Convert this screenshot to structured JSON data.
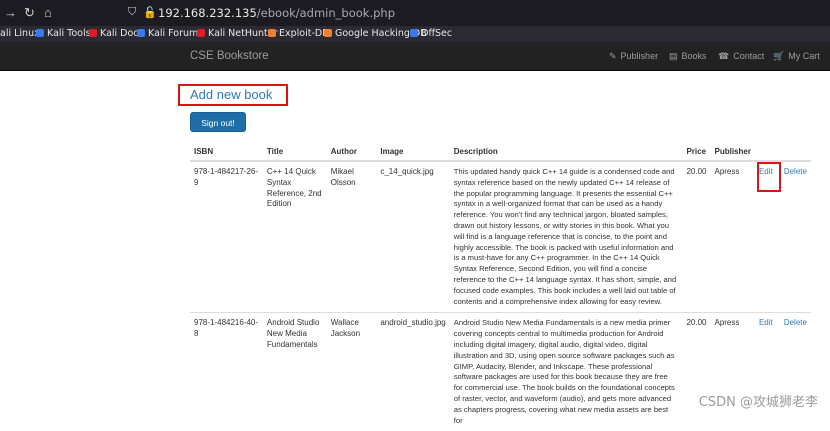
{
  "browser": {
    "url_host": "192.168.232.135",
    "url_path": "/ebook/admin_book.php",
    "bookmarks": [
      {
        "label": "ali Linux",
        "color": "#367bf0"
      },
      {
        "label": "Kali Tools",
        "color": "#e94b3c"
      },
      {
        "label": "Kali Docs",
        "color": "#e31b23"
      },
      {
        "label": "Kali Forums",
        "color": "#367bf0"
      },
      {
        "label": "Kali NetHunter",
        "color": "#e31b23"
      },
      {
        "label": "Exploit-DB",
        "color": "#f08030"
      },
      {
        "label": "Google Hacking DB",
        "color": "#f08030"
      },
      {
        "label": "OffSec",
        "color": "#367bf0"
      }
    ]
  },
  "navbar": {
    "brand": "CSE Bookstore",
    "links": {
      "publisher": "Publisher",
      "books": "Books",
      "contact": "Contact",
      "cart": "My Cart"
    }
  },
  "main": {
    "add_new_book": "Add new book",
    "sign_out": "Sign out!",
    "table": {
      "headers": {
        "isbn": "ISBN",
        "title": "Title",
        "author": "Author",
        "image": "Image",
        "description": "Description",
        "price": "Price",
        "publisher": "Publisher"
      },
      "rows": [
        {
          "isbn": "978-1-484217-26-9",
          "title": "C++ 14 Quick Syntax Reference, 2nd Edition",
          "author": "Mikael Olsson",
          "image": "c_14_quick.jpg",
          "description": "This updated handy quick C++ 14 guide is a condensed code and syntax reference based on the newly updated C++ 14 release of the popular programming language. It presents the essential C++ syntax in a well-organized format that can be used as a handy reference. You won't find any technical jargon, bloated samples, drawn out history lessons, or witty stories in this book. What you will find is a language reference that is concise, to the point and highly accessible. The book is packed with useful information and is a must-have for any C++ programmer. In the C++ 14 Quick Syntax Reference, Second Edition, you will find a concise reference to the C++ 14 language syntax. It has short, simple, and focused code examples. This book includes a well laid out table of contents and a comprehensive index allowing for easy review.",
          "price": "20.00",
          "publisher": "Apress",
          "edit": "Edit",
          "delete": "Delete"
        },
        {
          "isbn": "978-1-484216-40-8",
          "title": "Android Studio New Media Fundamentals",
          "author": "Wallace Jackson",
          "image": "android_studio.jpg",
          "description": "Android Studio New Media Fundamentals is a new media primer covering concepts central to multimedia production for Android including digital imagery, digital audio, digital video, digital illustration and 3D, using open source software packages such as GIMP, Audacity, Blender, and Inkscape. These professional software packages are used for this book because they are free for commercial use. The book builds on the foundational concepts of raster, vector, and waveform (audio), and gets more advanced as chapters progress, covering what new media assets are best for",
          "price": "20.00",
          "publisher": "Apress",
          "edit": "Edit",
          "delete": "Delete"
        }
      ]
    }
  },
  "watermark": "CSDN @攻城狮老李",
  "colors": {
    "link": "#337ab7",
    "highlight": "#e01212",
    "navbar": "#222222",
    "button": "#1e6ea8"
  }
}
